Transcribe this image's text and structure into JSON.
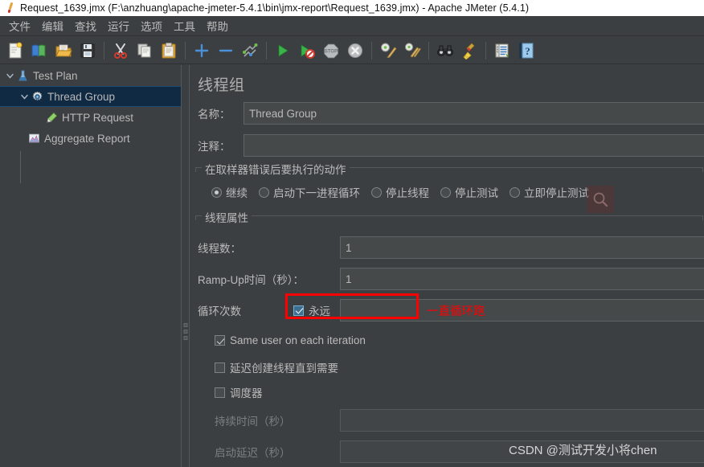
{
  "window": {
    "title": "Request_1639.jmx (F:\\anzhuang\\apache-jmeter-5.4.1\\bin\\jmx-report\\Request_1639.jmx) - Apache JMeter (5.4.1)",
    "icon": "jmeter-logo-icon"
  },
  "menubar": {
    "items": [
      {
        "label": "文件",
        "name": "menu-file"
      },
      {
        "label": "编辑",
        "name": "menu-edit"
      },
      {
        "label": "查找",
        "name": "menu-search"
      },
      {
        "label": "运行",
        "name": "menu-run"
      },
      {
        "label": "选项",
        "name": "menu-options"
      },
      {
        "label": "工具",
        "name": "menu-tools"
      },
      {
        "label": "帮助",
        "name": "menu-help"
      }
    ]
  },
  "toolbar": {
    "buttons": [
      {
        "name": "new-icon",
        "title": "新建"
      },
      {
        "name": "templates-icon",
        "title": "模板"
      },
      {
        "name": "open-icon",
        "title": "打开"
      },
      {
        "name": "save-icon",
        "title": "保存"
      },
      {
        "name": "cut-icon",
        "title": "剪切"
      },
      {
        "name": "copy-icon",
        "title": "复制"
      },
      {
        "name": "paste-icon",
        "title": "粘贴"
      },
      {
        "name": "expand-all-icon",
        "title": "展开全部"
      },
      {
        "name": "collapse-all-icon",
        "title": "折叠全部"
      },
      {
        "name": "toggle-icon",
        "title": "切换"
      },
      {
        "name": "start-icon",
        "title": "启动"
      },
      {
        "name": "start-no-pause-icon",
        "title": "无暂停启动"
      },
      {
        "name": "stop-icon",
        "title": "停止"
      },
      {
        "name": "shutdown-icon",
        "title": "关闭"
      },
      {
        "name": "clear-icon",
        "title": "清除"
      },
      {
        "name": "clear-all-icon",
        "title": "清除全部"
      },
      {
        "name": "search-icon",
        "title": "搜索"
      },
      {
        "name": "reset-search-icon",
        "title": "重置搜索"
      },
      {
        "name": "function-helper-icon",
        "title": "函数助手对话框"
      },
      {
        "name": "help-icon",
        "title": "帮助"
      }
    ]
  },
  "tree": {
    "nodes": [
      {
        "label": "Test Plan",
        "icon": "test-plan-icon",
        "depth": 0,
        "expanded": true,
        "selected": false,
        "name": "tree-node-test-plan"
      },
      {
        "label": "Thread Group",
        "icon": "thread-group-icon",
        "depth": 1,
        "expanded": true,
        "selected": true,
        "name": "tree-node-thread-group"
      },
      {
        "label": "HTTP Request",
        "icon": "http-request-icon",
        "depth": 2,
        "expanded": false,
        "selected": false,
        "name": "tree-node-http-request"
      },
      {
        "label": "Aggregate Report",
        "icon": "aggregate-report-icon",
        "depth": 1,
        "expanded": false,
        "selected": false,
        "name": "tree-node-aggregate-report"
      }
    ]
  },
  "panel": {
    "title": "线程组",
    "name_label": "名称：",
    "name_value": "Thread Group",
    "comment_label": "注释：",
    "comment_value": "",
    "error_action": {
      "group_title": "在取样器错误后要执行的动作",
      "options": [
        {
          "label": "继续",
          "checked": true,
          "name": "radio-continue"
        },
        {
          "label": "启动下一进程循环",
          "checked": false,
          "name": "radio-start-next-loop"
        },
        {
          "label": "停止线程",
          "checked": false,
          "name": "radio-stop-thread"
        },
        {
          "label": "停止测试",
          "checked": false,
          "name": "radio-stop-test"
        },
        {
          "label": "立即停止测试",
          "checked": false,
          "name": "radio-stop-test-now"
        }
      ]
    },
    "thread_properties": {
      "group_title": "线程属性",
      "threads_label": "线程数：",
      "threads_value": "1",
      "rampup_label": "Ramp-Up时间（秒）：",
      "rampup_value": "1",
      "loops_label": "循环次数",
      "forever_label": "永远",
      "forever_checked": true,
      "loops_value": ""
    },
    "checkboxes": [
      {
        "label": "Same user on each iteration",
        "checked": true,
        "disabled": false,
        "name": "checkbox-same-user"
      },
      {
        "label": "延迟创建线程直到需要",
        "checked": false,
        "disabled": false,
        "name": "checkbox-delay-thread-creation"
      },
      {
        "label": "调度器",
        "checked": false,
        "disabled": false,
        "name": "checkbox-scheduler"
      }
    ],
    "scheduler": {
      "duration_label": "持续时间（秒）",
      "duration_value": "",
      "startup_delay_label": "启动延迟（秒）",
      "startup_delay_value": ""
    }
  },
  "annotations": {
    "red_note": "一直循环跑",
    "red_color": "#ff0000"
  },
  "watermarks": {
    "credit": "CSDN @测试开发小将chen",
    "search_badge": "search-icon"
  }
}
